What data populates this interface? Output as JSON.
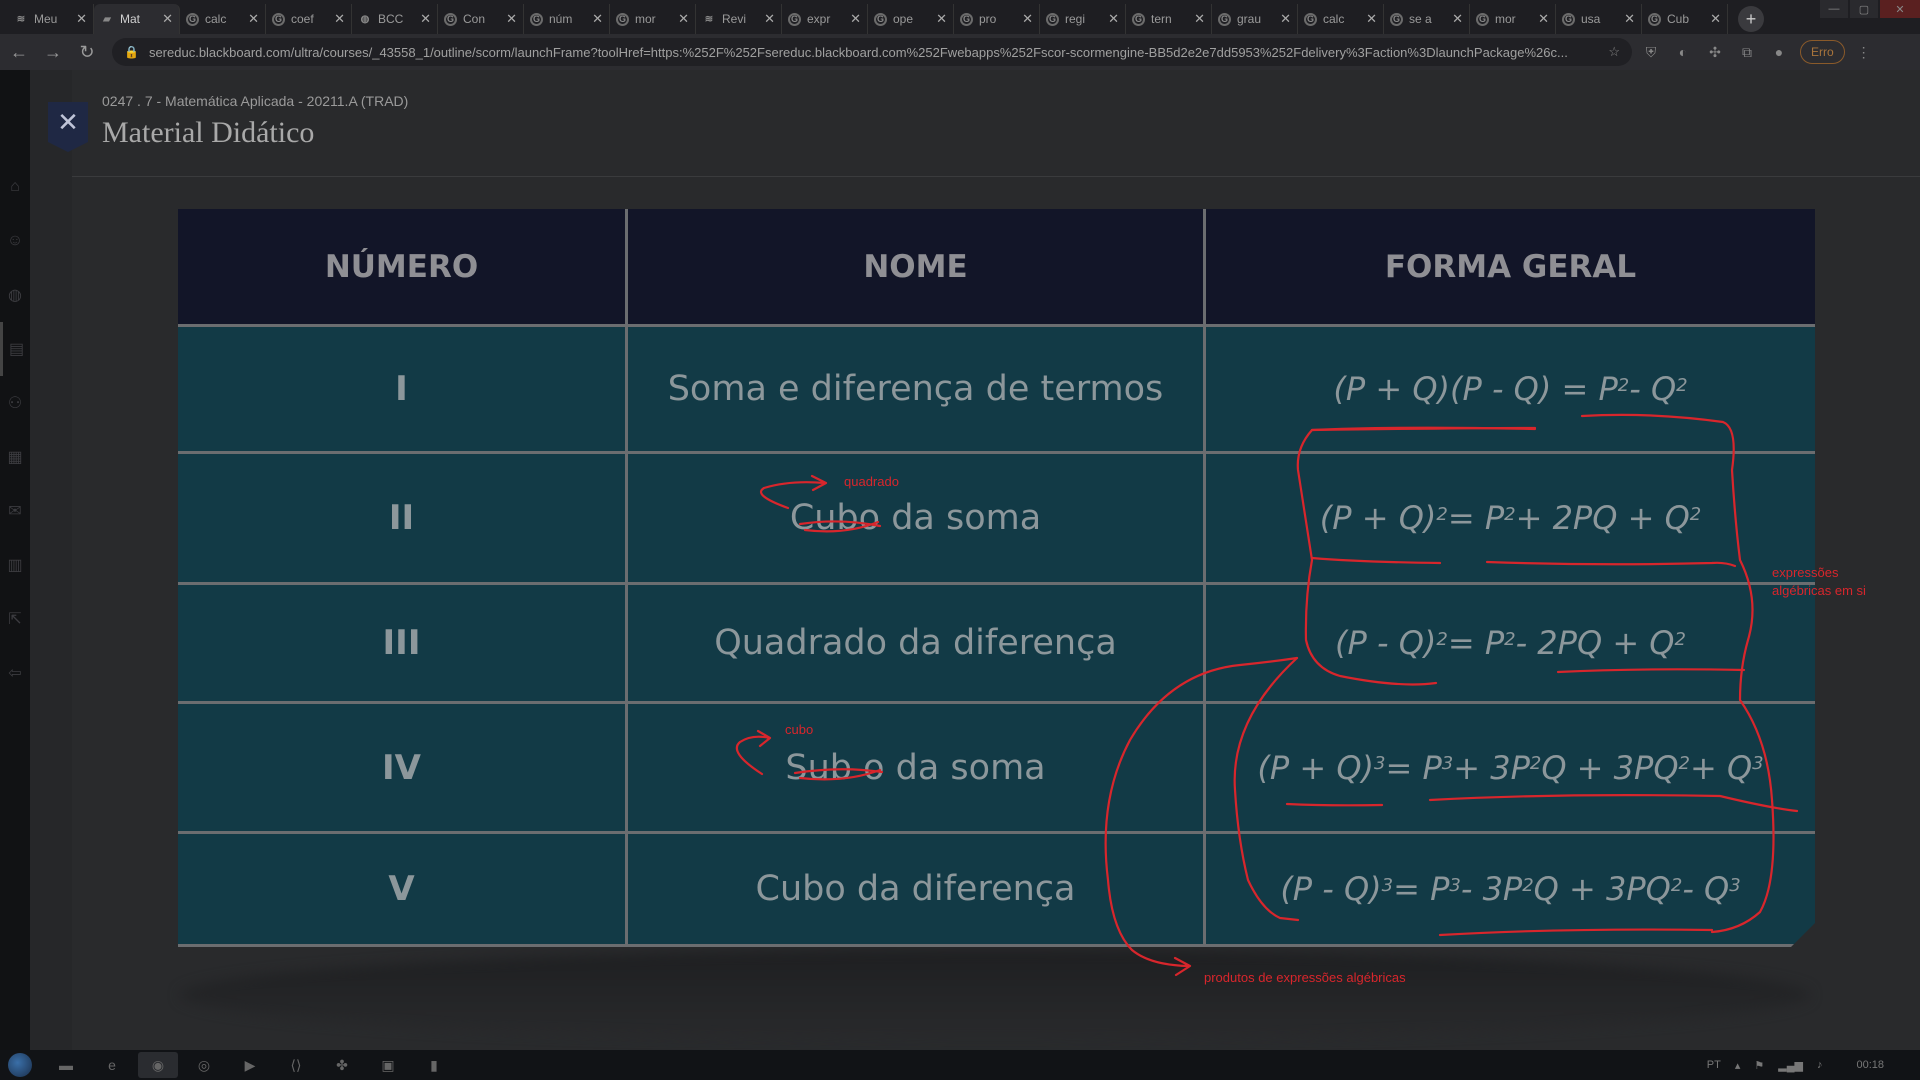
{
  "browser": {
    "tabs": [
      {
        "title": "Meu",
        "icon": "wave",
        "active": false
      },
      {
        "title": "Mat",
        "icon": "book",
        "active": true
      },
      {
        "title": "calc",
        "icon": "G",
        "active": false
      },
      {
        "title": "coef",
        "icon": "G",
        "active": false
      },
      {
        "title": "BCC",
        "icon": "globe",
        "active": false
      },
      {
        "title": "Con",
        "icon": "G",
        "active": false
      },
      {
        "title": "núm",
        "icon": "G",
        "active": false
      },
      {
        "title": "mor",
        "icon": "G",
        "active": false
      },
      {
        "title": "Revi",
        "icon": "wave",
        "active": false
      },
      {
        "title": "expr",
        "icon": "G",
        "active": false
      },
      {
        "title": "ope",
        "icon": "G",
        "active": false
      },
      {
        "title": "pro",
        "icon": "G",
        "active": false
      },
      {
        "title": "regi",
        "icon": "G",
        "active": false
      },
      {
        "title": "tern",
        "icon": "G",
        "active": false
      },
      {
        "title": "grau",
        "icon": "G",
        "active": false
      },
      {
        "title": "calc",
        "icon": "G",
        "active": false
      },
      {
        "title": "se a",
        "icon": "G",
        "active": false
      },
      {
        "title": "mor",
        "icon": "G",
        "active": false
      },
      {
        "title": "usa",
        "icon": "G",
        "active": false
      },
      {
        "title": "Cub",
        "icon": "G",
        "active": false
      }
    ],
    "new_tab": "+",
    "url": "sereduc.blackboard.com/ultra/courses/_43558_1/outline/scorm/launchFrame?toolHref=https:%252F%252Fsereduc.blackboard.com%252Fwebapps%252Fscor-scormengine-BB5d2e2e7dd5953%252Fdelivery%3Faction%3DlaunchPackage%26c...",
    "error_button": "Erro"
  },
  "page": {
    "breadcrumb": "0247 . 7 - Matemática Aplicada - 20211.A (TRAD)",
    "title": "Material Didático",
    "close": "✕"
  },
  "table": {
    "headers": [
      "NÚMERO",
      "NOME",
      "FORMA GERAL"
    ],
    "rows": [
      {
        "num": "I",
        "name": "Soma e diferença de termos",
        "formula": [
          "(P + Q)(P - Q) = P",
          "2",
          " - Q",
          "2"
        ]
      },
      {
        "num": "II",
        "name": "Cubo da soma",
        "formula": [
          "(P + Q)",
          "2",
          " = P",
          "2",
          " + 2PQ + Q",
          "2"
        ]
      },
      {
        "num": "III",
        "name": "Quadrado da diferença",
        "formula": [
          "(P - Q)",
          "2",
          " = P",
          "2",
          " - 2PQ + Q",
          "2"
        ]
      },
      {
        "num": "IV",
        "name": "Sub o da soma",
        "formula": [
          "(P + Q)",
          "3",
          " = P",
          "3",
          " + 3P",
          "2",
          "Q + 3PQ",
          "2",
          " + Q",
          "3"
        ]
      },
      {
        "num": "V",
        "name": "Cubo da diferença",
        "formula": [
          "(P - Q)",
          "3",
          " = P",
          "3",
          " - 3P",
          "2",
          "Q + 3PQ",
          "2",
          " - Q",
          "3"
        ]
      }
    ]
  },
  "annotations": {
    "quadrado": "quadrado",
    "cubo": "cubo",
    "expressoes": "expressões algébricas em si",
    "produtos": "produtos de expressões algébricas",
    "color": "#d8262c"
  },
  "taskbar": {
    "lang": "PT",
    "time": "00:18"
  }
}
